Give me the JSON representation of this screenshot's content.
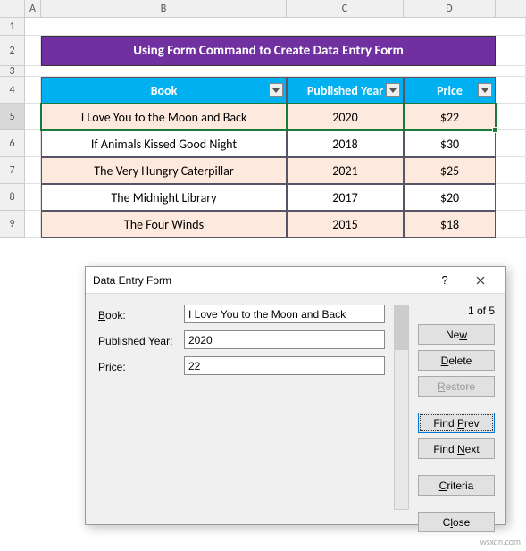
{
  "columns": [
    "A",
    "B",
    "C",
    "D"
  ],
  "rows": [
    "1",
    "2",
    "3",
    "4",
    "5",
    "6",
    "7",
    "8",
    "9"
  ],
  "selected_row": "5",
  "title": "Using Form Command to Create Data Entry Form",
  "table": {
    "headers": [
      "Book",
      "Published Year",
      "Price"
    ],
    "rows": [
      {
        "book": "I Love You to the Moon and Back",
        "year": "2020",
        "price": "$22"
      },
      {
        "book": "If Animals Kissed Good Night",
        "year": "2018",
        "price": "$30"
      },
      {
        "book": "The Very Hungry Caterpillar",
        "year": "2021",
        "price": "$25"
      },
      {
        "book": "The Midnight Library",
        "year": "2017",
        "price": "$20"
      },
      {
        "book": "The Four Winds",
        "year": "2015",
        "price": "$18"
      }
    ]
  },
  "dialog": {
    "title": "Data Entry Form",
    "help": "?",
    "counter": "1 of 5",
    "fields": {
      "book_label": "Book:",
      "book_value": "I Love You to the Moon and Back",
      "year_label": "Published Year:",
      "year_value": "2020",
      "price_label": "Price:",
      "price_value": "22"
    },
    "buttons": {
      "new": "New",
      "delete": "Delete",
      "restore": "Restore",
      "find_prev": "Find Prev",
      "find_next": "Find Next",
      "criteria": "Criteria",
      "close": "Close"
    }
  },
  "watermark": "wsxdn.com"
}
